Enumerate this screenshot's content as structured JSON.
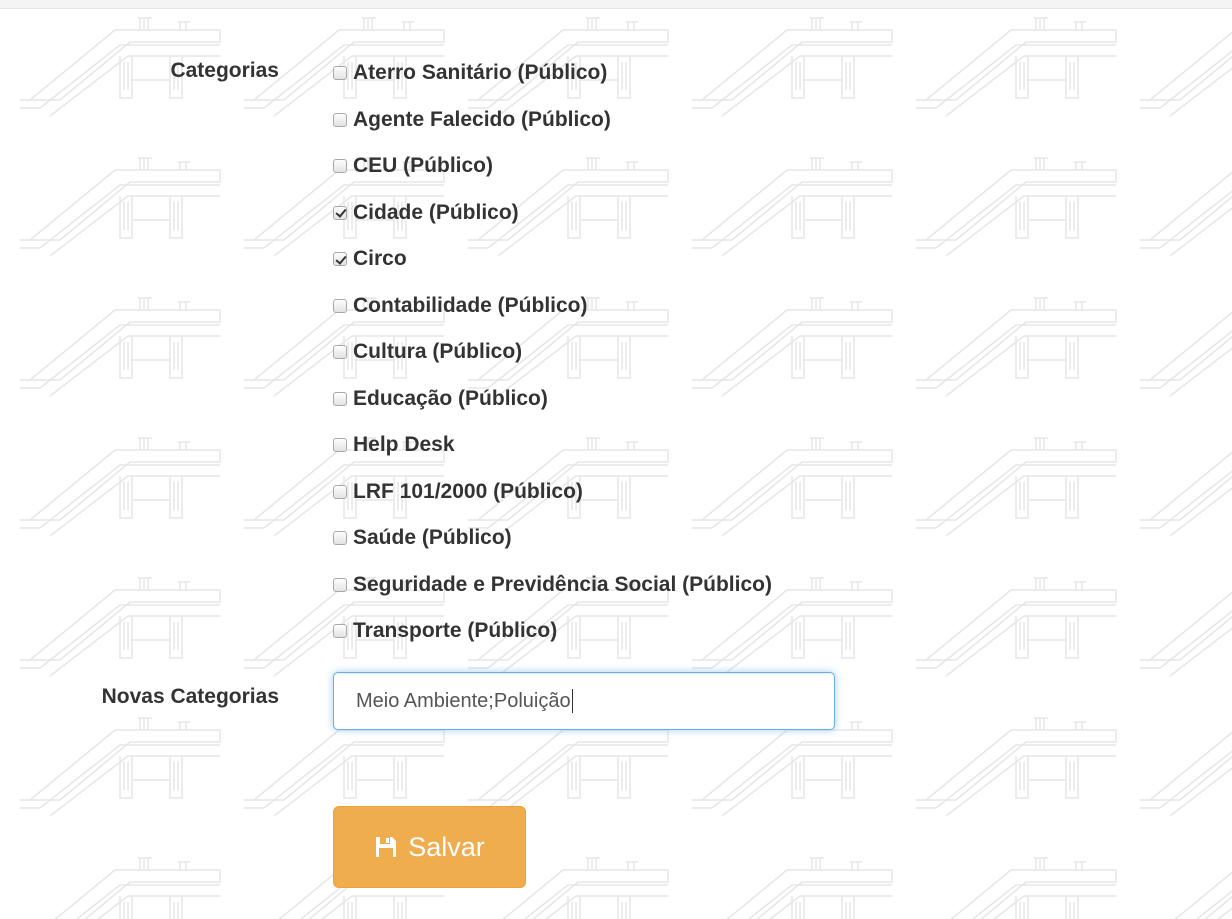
{
  "form": {
    "categories_label": "Categorias",
    "categories": [
      {
        "label": "Aterro Sanitário (Público)",
        "checked": false
      },
      {
        "label": "Agente Falecido (Público)",
        "checked": false
      },
      {
        "label": "CEU (Público)",
        "checked": false
      },
      {
        "label": "Cidade (Público)",
        "checked": true
      },
      {
        "label": "Circo",
        "checked": true
      },
      {
        "label": "Contabilidade (Público)",
        "checked": false
      },
      {
        "label": "Cultura (Público)",
        "checked": false
      },
      {
        "label": "Educação (Público)",
        "checked": false
      },
      {
        "label": "Help Desk",
        "checked": false
      },
      {
        "label": "LRF 101/2000 (Público)",
        "checked": false
      },
      {
        "label": "Saúde (Público)",
        "checked": false
      },
      {
        "label": "Seguridade e Previdência Social (Público)",
        "checked": false
      },
      {
        "label": "Transporte (Público)",
        "checked": false
      }
    ],
    "new_categories_label": "Novas Categorias",
    "new_categories_value": "Meio Ambiente;Poluição",
    "save_label": "Salvar",
    "save_icon": "floppy-disk-icon"
  },
  "colors": {
    "button_bg": "#f0ad4e",
    "input_focus_border": "#66afe9",
    "text": "#333333"
  }
}
